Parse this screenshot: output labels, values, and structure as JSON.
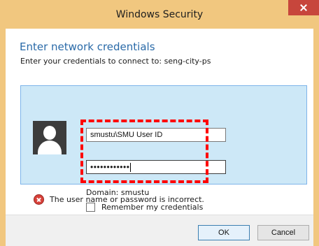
{
  "window": {
    "title": "Windows Security",
    "close_icon": "close-icon",
    "titlebar_color": "#f1c77f"
  },
  "dialog": {
    "heading": "Enter network credentials",
    "subheading": "Enter your credentials to connect to: seng-city-ps"
  },
  "credentials": {
    "username_value": "smustu\\SMU User ID",
    "password_value": "••••••••••••",
    "domain_text": "Domain: smustu",
    "remember_label": "Remember my credentials",
    "remember_checked": false,
    "avatar_icon": "user-avatar-icon",
    "highlight_color": "#ff0000"
  },
  "error": {
    "icon": "error-icon",
    "message": "The user name or password is incorrect."
  },
  "buttons": {
    "ok_label": "OK",
    "cancel_label": "Cancel"
  }
}
